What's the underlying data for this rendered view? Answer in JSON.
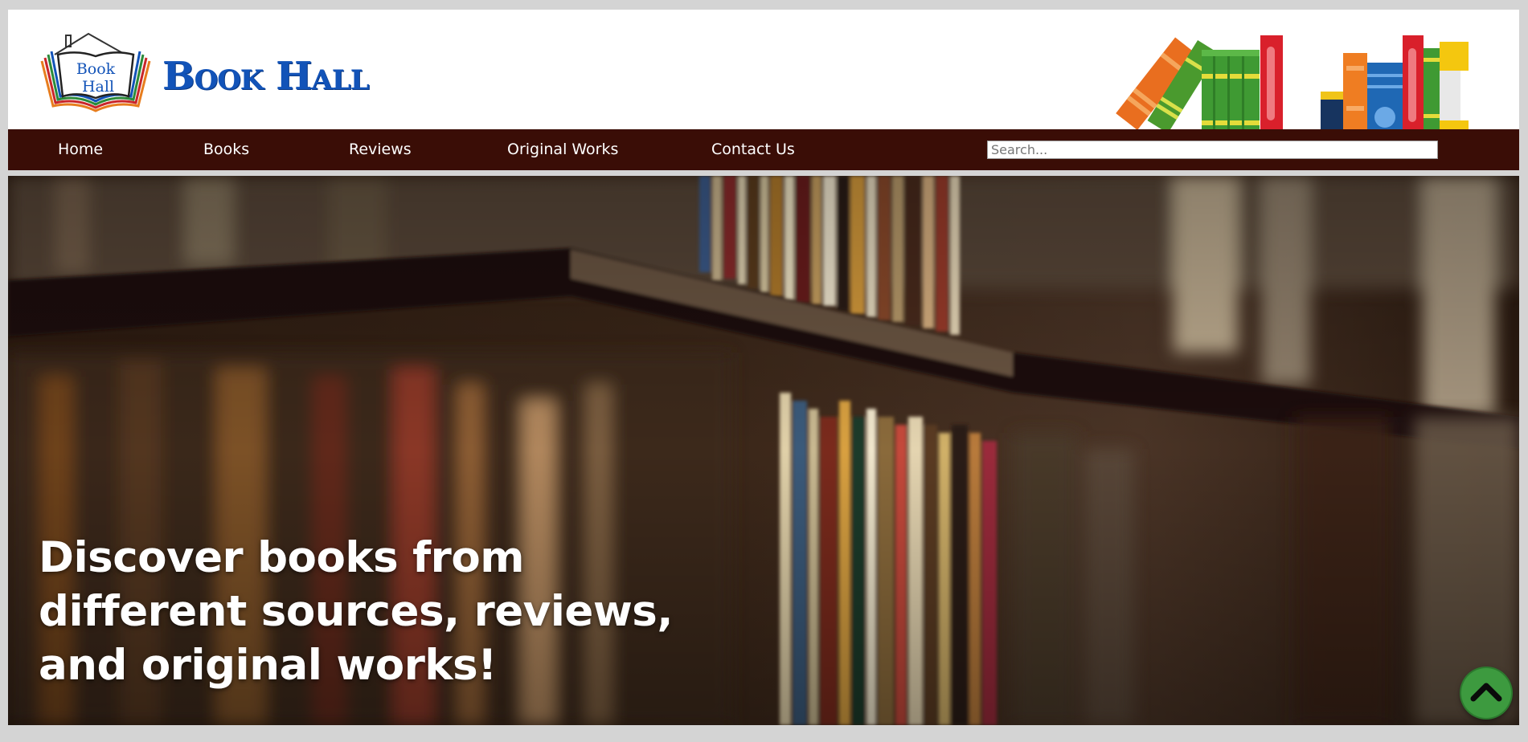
{
  "brand": {
    "name": "Book Hall",
    "logo_text_line1": "Book",
    "logo_text_line2": "Hall"
  },
  "nav": {
    "items": [
      {
        "label": "Home"
      },
      {
        "label": "Books"
      },
      {
        "label": "Reviews"
      },
      {
        "label": "Original Works"
      },
      {
        "label": "Contact Us"
      }
    ]
  },
  "search": {
    "value": "",
    "placeholder": "Search..."
  },
  "hero": {
    "heading": "Discover books from different sources, reviews, and original works!"
  },
  "icons": {
    "scroll_top": "chevron-up-icon",
    "header_art": "books-illustration-icon",
    "logo": "book-hall-logo-icon"
  },
  "colors": {
    "nav_background": "#3a0d06",
    "brand_blue": "#1253b8",
    "scroll_button": "#3d9a3f",
    "page_border": "#d4d4d4"
  }
}
